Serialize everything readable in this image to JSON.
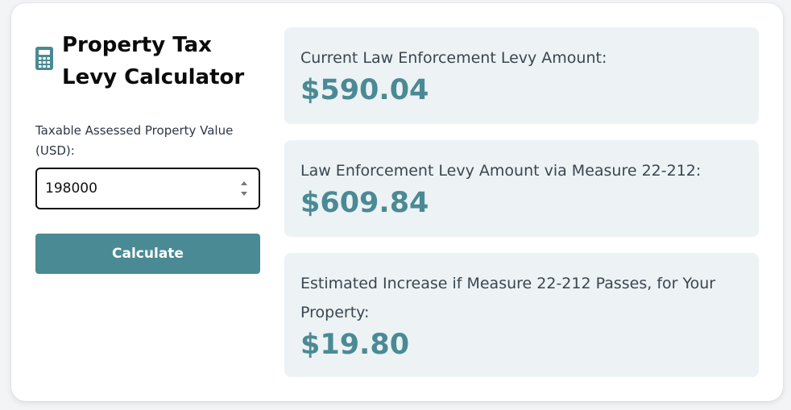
{
  "calculator": {
    "title_line1": "Property Tax",
    "title_line2": "Levy Calculator",
    "icon": "calculator-icon",
    "input_label": "Taxable Assessed Property Value (USD):",
    "input_value": "198000",
    "button_label": "Calculate"
  },
  "results": [
    {
      "label": "Current Law Enforcement Levy Amount:",
      "value": "$590.04"
    },
    {
      "label": "Law Enforcement Levy Amount via Measure 22-212:",
      "value": "$609.84"
    },
    {
      "label": "Estimated Increase if Measure 22-212 Passes, for Your Property:",
      "value": "$19.80"
    }
  ],
  "colors": {
    "accent": "#4a8a94",
    "result_background": "#edf2f4",
    "text": "#3a4650"
  }
}
